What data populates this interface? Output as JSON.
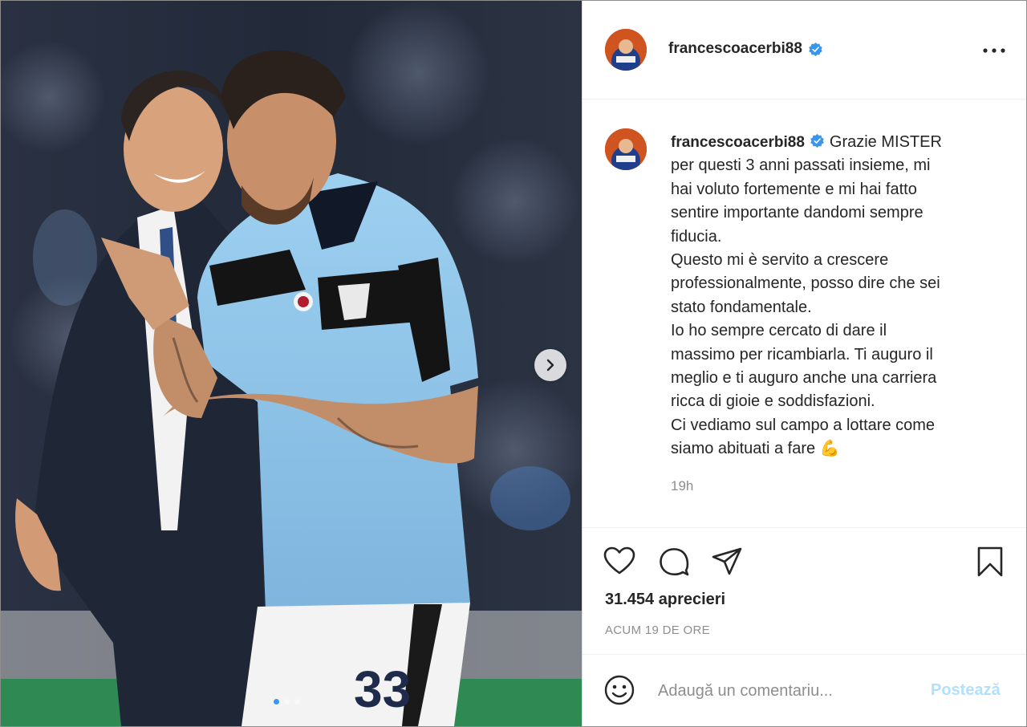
{
  "post": {
    "username": "francescoacerbi88",
    "verified": true,
    "caption_lines": [
      "Grazie MISTER",
      "per questi 3 anni passati insieme, mi",
      "hai voluto fortemente e mi hai fatto",
      "sentire importante dandomi sempre",
      "fiducia.",
      "Questo mi è servito a crescere",
      "professionalmente, posso dire che sei",
      "stato fondamentale.",
      "Io ho sempre cercato di dare il",
      "massimo per ricambiarla. Ti auguro il",
      "meglio e ti auguro anche una carriera",
      "ricca di gioie e soddisfazioni.",
      "Ci vediamo sul campo a lottare come",
      "siamo abituati a fare"
    ],
    "caption_emoji": "💪",
    "time_relative": "19h",
    "likes_text": "31.454 aprecieri",
    "posted_ago": "ACUM 19 DE ORE"
  },
  "photo": {
    "jersey_number": "33",
    "carousel": {
      "count": 3,
      "active_index": 0
    }
  },
  "comment": {
    "placeholder": "Adaugă un comentariu...",
    "post_label": "Postează"
  },
  "icons": {
    "more": "more-options-icon",
    "like": "heart-icon",
    "comment": "comment-icon",
    "share": "paper-plane-icon",
    "save": "bookmark-icon",
    "emoji": "smiley-icon",
    "next": "chevron-right-icon",
    "verified": "verified-badge-icon"
  },
  "colors": {
    "verified_blue": "#3797f0",
    "post_button_disabled": "#b2dffc",
    "secondary_text": "#8e8e8e",
    "jersey_sky_blue": "#8fc3e8"
  }
}
